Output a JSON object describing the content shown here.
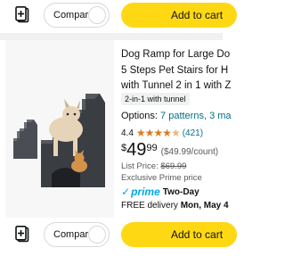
{
  "top_row": {
    "compare_label": "Compare",
    "add_to_cart_label": "Add to cart"
  },
  "product": {
    "title_lines": [
      "Dog Ramp for Large Do",
      "5 Steps Pet Stairs for H",
      "with Tunnel 2 in 1 with Z"
    ],
    "badge": "2-in-1 with tunnel",
    "options_prefix": "Options: ",
    "options_link": "7 patterns, 3 ma",
    "rating_value": "4.4",
    "rating_count": "(421)",
    "price_symbol": "$",
    "price_whole": "49",
    "price_fraction": "99",
    "unit_price": "($49.99/count)",
    "list_price_label": "List Price: ",
    "list_price_value": "$69.99",
    "exclusive_text": "Exclusive Prime price",
    "prime_word": "prime",
    "prime_speed": "Two-Day",
    "delivery_prefix": "FREE delivery ",
    "delivery_date": "Mon, May 4"
  },
  "bottom_row": {
    "compare_label": "Compare",
    "add_to_cart_label": "Add to cart"
  },
  "colors": {
    "cart_button": "#FFD814",
    "link": "#007185",
    "star": "#DE7921",
    "prime": "#00A8E1"
  },
  "icons": {
    "add_to_list": "add-to-list-icon",
    "star": "star-icon",
    "prime_check": "prime-check-icon"
  }
}
